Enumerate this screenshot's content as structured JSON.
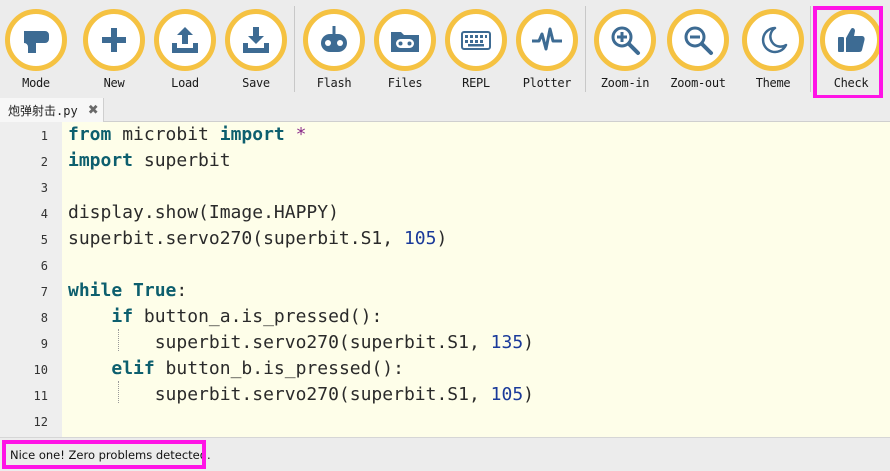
{
  "toolbar": {
    "buttons": [
      {
        "id": "mode",
        "label": "Mode",
        "icon": "mode-icon"
      },
      {
        "id": "new",
        "label": "New",
        "icon": "plus-icon"
      },
      {
        "id": "load",
        "label": "Load",
        "icon": "upload-icon"
      },
      {
        "id": "save",
        "label": "Save",
        "icon": "download-icon"
      },
      {
        "id": "flash",
        "label": "Flash",
        "icon": "microbit-icon"
      },
      {
        "id": "files",
        "label": "Files",
        "icon": "folder-icon"
      },
      {
        "id": "repl",
        "label": "REPL",
        "icon": "keyboard-icon"
      },
      {
        "id": "plotter",
        "label": "Plotter",
        "icon": "pulse-icon"
      },
      {
        "id": "zoom_in",
        "label": "Zoom-in",
        "icon": "zoom-in-icon"
      },
      {
        "id": "zoom_out",
        "label": "Zoom-out",
        "icon": "zoom-out-icon"
      },
      {
        "id": "theme",
        "label": "Theme",
        "icon": "moon-icon"
      },
      {
        "id": "check",
        "label": "Check",
        "icon": "thumbs-up-icon"
      }
    ],
    "icon_color": "#3d6b93",
    "ring_color": "#f5c242",
    "highlight_color": "#ff14e6"
  },
  "tab": {
    "filename": "炮弹射击.py",
    "close_symbol": "✖"
  },
  "editor": {
    "lines": [
      {
        "n": "1",
        "tokens": [
          {
            "t": "from",
            "c": "kw"
          },
          {
            "t": " microbit "
          },
          {
            "t": "import",
            "c": "kw"
          },
          {
            "t": " "
          },
          {
            "t": "*",
            "c": "op"
          }
        ]
      },
      {
        "n": "2",
        "tokens": [
          {
            "t": "import",
            "c": "kw"
          },
          {
            "t": " superbit"
          }
        ]
      },
      {
        "n": "3",
        "tokens": []
      },
      {
        "n": "4",
        "tokens": [
          {
            "t": "display.show(Image.HAPPY)"
          }
        ]
      },
      {
        "n": "5",
        "tokens": [
          {
            "t": "superbit.servo270(superbit.S1, "
          },
          {
            "t": "105",
            "c": "num"
          },
          {
            "t": ")"
          }
        ]
      },
      {
        "n": "6",
        "tokens": []
      },
      {
        "n": "7",
        "tokens": [
          {
            "t": "while",
            "c": "kw"
          },
          {
            "t": " "
          },
          {
            "t": "True",
            "c": "kw"
          },
          {
            "t": ":"
          }
        ]
      },
      {
        "n": "8",
        "tokens": [
          {
            "t": "    "
          },
          {
            "t": "if",
            "c": "kw"
          },
          {
            "t": " button_a.is_pressed():"
          }
        ]
      },
      {
        "n": "9",
        "tokens": [
          {
            "t": "        superbit.servo270(superbit.S1, "
          },
          {
            "t": "135",
            "c": "num"
          },
          {
            "t": ")"
          }
        ]
      },
      {
        "n": "10",
        "tokens": [
          {
            "t": "    "
          },
          {
            "t": "elif",
            "c": "kw"
          },
          {
            "t": " button_b.is_pressed():"
          }
        ]
      },
      {
        "n": "11",
        "tokens": [
          {
            "t": "        superbit.servo270(superbit.S1, "
          },
          {
            "t": "105",
            "c": "num"
          },
          {
            "t": ")"
          }
        ]
      },
      {
        "n": "12",
        "tokens": []
      }
    ]
  },
  "status": {
    "message": "Nice one! Zero problems detected."
  }
}
